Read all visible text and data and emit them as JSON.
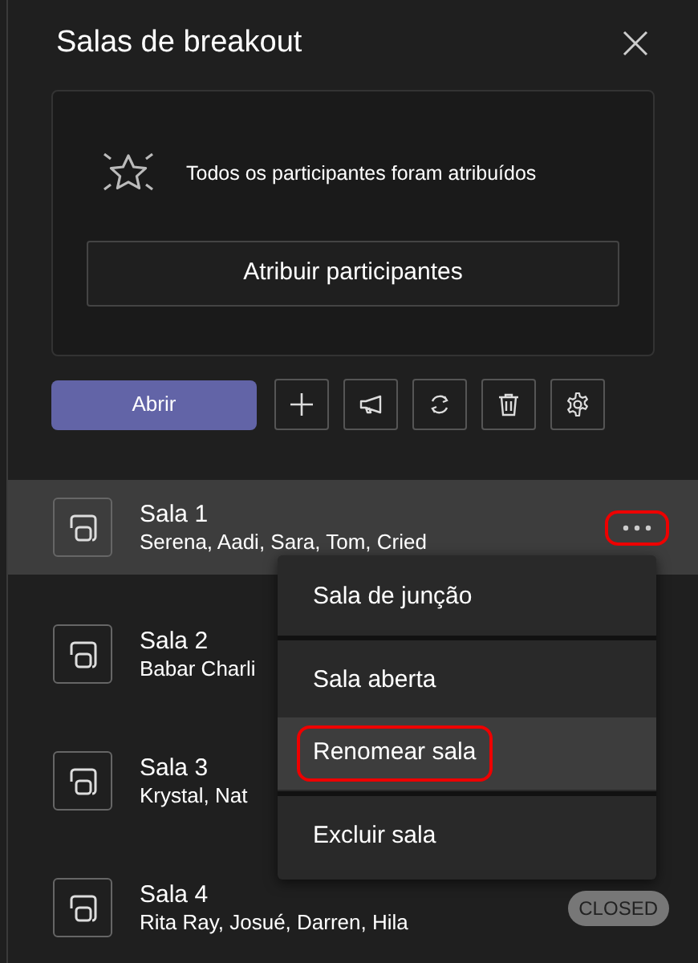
{
  "header": {
    "title": "Salas de breakout"
  },
  "assign_card": {
    "message": "Todos os participantes foram atribuídos",
    "button": "Atribuir participantes"
  },
  "toolbar": {
    "primary": "Abrir",
    "tools": [
      {
        "kind": "add"
      },
      {
        "kind": "announce"
      },
      {
        "kind": "recreate"
      },
      {
        "kind": "delete"
      },
      {
        "kind": "settings"
      }
    ]
  },
  "rooms": [
    {
      "name": "Sala 1",
      "participants": "Serena, Aadi, Sara, Tom, Cried",
      "selected": true,
      "more_button": {
        "highlighted": true
      }
    },
    {
      "name": "Sala 2",
      "participants": "Babar Charli",
      "selected": false
    },
    {
      "name": "Sala 3",
      "participants": "Krystal, Nat",
      "selected": false
    },
    {
      "name": "Sala 4",
      "participants": "Rita Ray, Josué, Darren, Hila",
      "selected": false,
      "status": "CLOSED"
    }
  ],
  "context_menu": {
    "items": [
      {
        "label": "Sala de junção",
        "hovered": false,
        "highlighted": false,
        "divider_after": true
      },
      {
        "label": "Sala aberta",
        "hovered": false,
        "highlighted": false,
        "divider_after": false
      },
      {
        "label": "Renomear sala",
        "hovered": true,
        "highlighted": true,
        "divider_after": true
      },
      {
        "label": "Excluir sala",
        "hovered": false,
        "highlighted": false,
        "divider_after": false
      }
    ]
  }
}
